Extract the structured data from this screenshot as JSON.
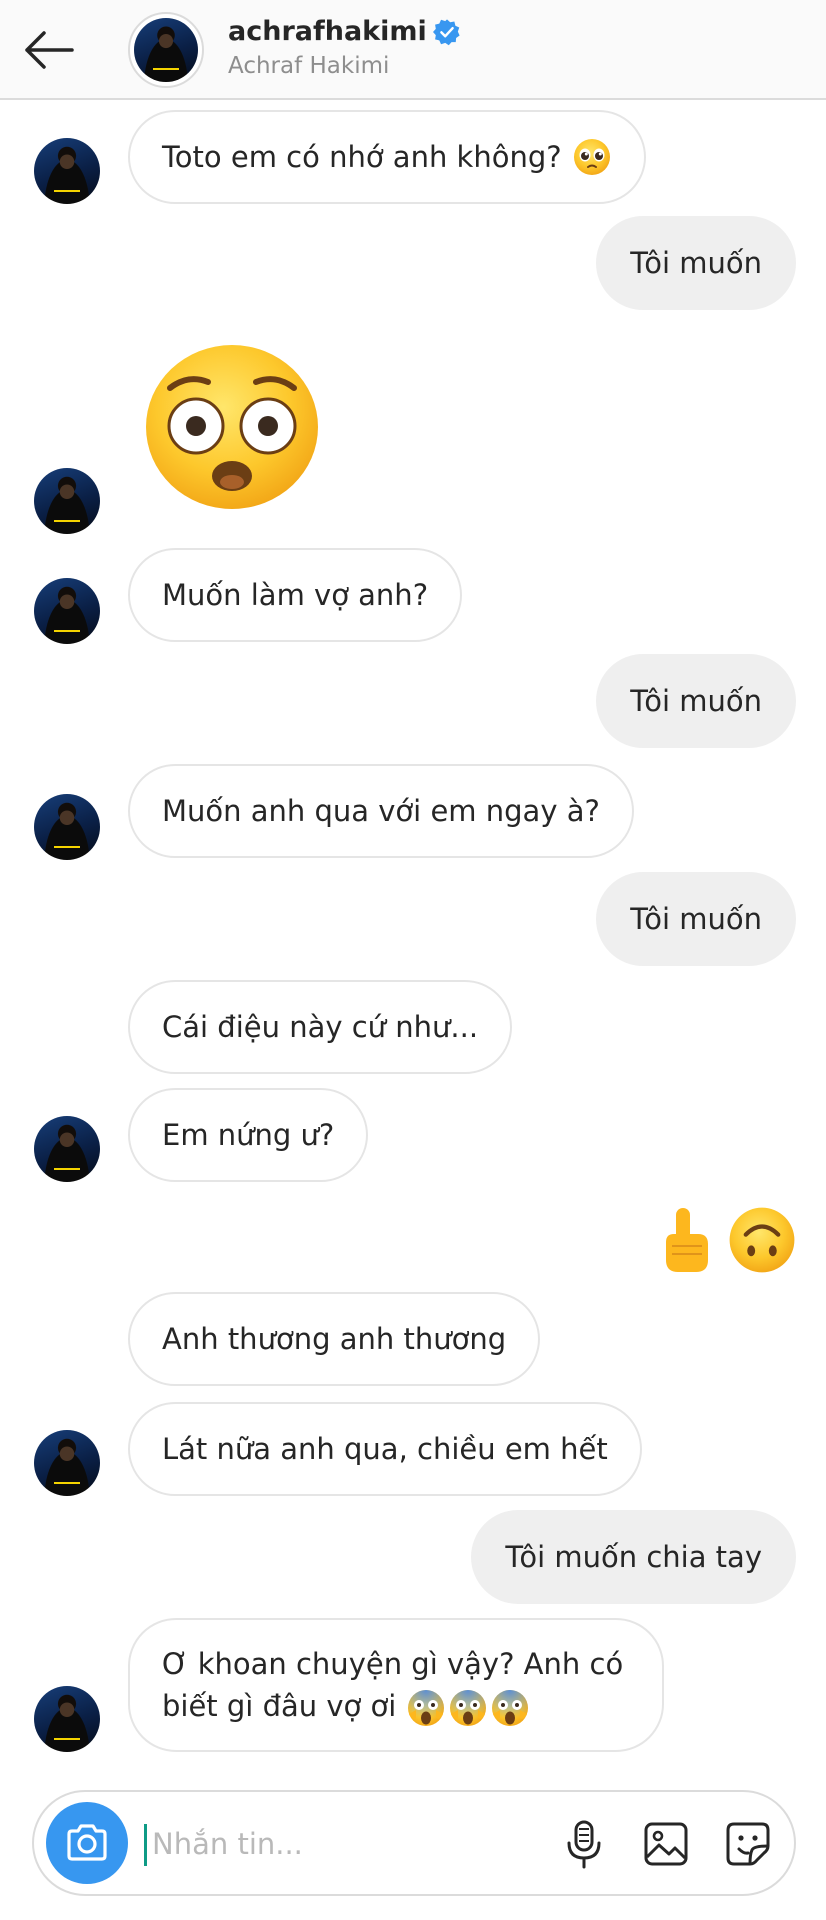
{
  "header": {
    "username": "achrafhakimi",
    "full_name": "Achraf Hakimi",
    "verified_color": "#3897f0"
  },
  "messages": [
    {
      "dir": "in",
      "text": "Toto em có nhớ anh không?",
      "emoji": "pleading-face"
    },
    {
      "dir": "out",
      "text": "Tôi muốn"
    },
    {
      "dir": "in",
      "emoji": "flushed-face"
    },
    {
      "dir": "in",
      "text": "Muốn làm vợ anh?"
    },
    {
      "dir": "out",
      "text": "Tôi muốn"
    },
    {
      "dir": "in",
      "text": "Muốn anh qua với em ngay à?"
    },
    {
      "dir": "out",
      "text": "Tôi muốn"
    },
    {
      "dir": "in",
      "text": "Cái điệu này cứ như..."
    },
    {
      "dir": "in",
      "text": "Em nứng ư?"
    },
    {
      "dir": "out",
      "emoji": "pointing-up-hand, upside-down-face"
    },
    {
      "dir": "in",
      "text": "Anh thương anh thương"
    },
    {
      "dir": "in",
      "text": "Lát nữa anh qua, chiều em hết"
    },
    {
      "dir": "out",
      "text": "Tôi muốn chia tay"
    },
    {
      "dir": "in",
      "text": "Ơ khoan chuyện gì vậy? Anh có biết gì đâu vợ ơi",
      "emoji": "screaming-face x3"
    }
  ],
  "composer": {
    "placeholder": "Nhắn tin..."
  },
  "icons": [
    "back-arrow-icon",
    "verified-badge-icon",
    "camera-icon",
    "microphone-icon",
    "gallery-icon",
    "sticker-icon"
  ],
  "colors": {
    "accent": "#3797f0",
    "incoming_bubble_border": "#e5e5e5",
    "outgoing_bubble_bg": "#efefef"
  }
}
